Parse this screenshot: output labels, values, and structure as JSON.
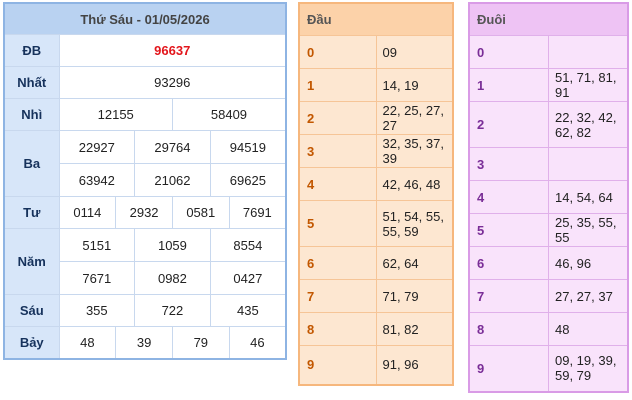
{
  "results": {
    "header": "Thứ Sáu - 01/05/2026",
    "db": {
      "label": "ĐB",
      "values": [
        "96637"
      ]
    },
    "nhat": {
      "label": "Nhất",
      "values": [
        "93296"
      ]
    },
    "nhi": {
      "label": "Nhì",
      "values": [
        "12155",
        "58409"
      ]
    },
    "ba": {
      "label": "Ba",
      "values": [
        "22927",
        "29764",
        "94519",
        "63942",
        "21062",
        "69625"
      ]
    },
    "tu": {
      "label": "Tư",
      "values": [
        "0114",
        "2932",
        "0581",
        "7691"
      ]
    },
    "nam": {
      "label": "Năm",
      "values": [
        "5151",
        "1059",
        "8554",
        "7671",
        "0982",
        "0427"
      ]
    },
    "sau": {
      "label": "Sáu",
      "values": [
        "355",
        "722",
        "435"
      ]
    },
    "bay": {
      "label": "Bảy",
      "values": [
        "48",
        "39",
        "79",
        "46"
      ]
    }
  },
  "dau": {
    "header": "Đầu",
    "rows": [
      {
        "key": "0",
        "value": "09"
      },
      {
        "key": "1",
        "value": "14, 19"
      },
      {
        "key": "2",
        "value": "22, 25, 27, 27"
      },
      {
        "key": "3",
        "value": "32, 35, 37, 39"
      },
      {
        "key": "4",
        "value": "42, 46, 48"
      },
      {
        "key": "5",
        "value": "51, 54, 55, 55, 59"
      },
      {
        "key": "6",
        "value": "62, 64"
      },
      {
        "key": "7",
        "value": "71, 79"
      },
      {
        "key": "8",
        "value": "81, 82"
      },
      {
        "key": "9",
        "value": "91, 96"
      }
    ]
  },
  "duoi": {
    "header": "Đuôi",
    "rows": [
      {
        "key": "0",
        "value": ""
      },
      {
        "key": "1",
        "value": "51, 71, 81, 91"
      },
      {
        "key": "2",
        "value": "22, 32, 42, 62, 82"
      },
      {
        "key": "3",
        "value": ""
      },
      {
        "key": "4",
        "value": "14, 54, 64"
      },
      {
        "key": "5",
        "value": "25, 35, 55, 55"
      },
      {
        "key": "6",
        "value": "46, 96"
      },
      {
        "key": "7",
        "value": "27, 27, 37"
      },
      {
        "key": "8",
        "value": "48"
      },
      {
        "key": "9",
        "value": "09, 19, 39, 59, 79"
      }
    ]
  },
  "colors": {
    "special_prize": "#e3161c",
    "results_border": "#8eb4e3",
    "dau_border": "#f6b77d",
    "duoi_border": "#d99be6"
  }
}
